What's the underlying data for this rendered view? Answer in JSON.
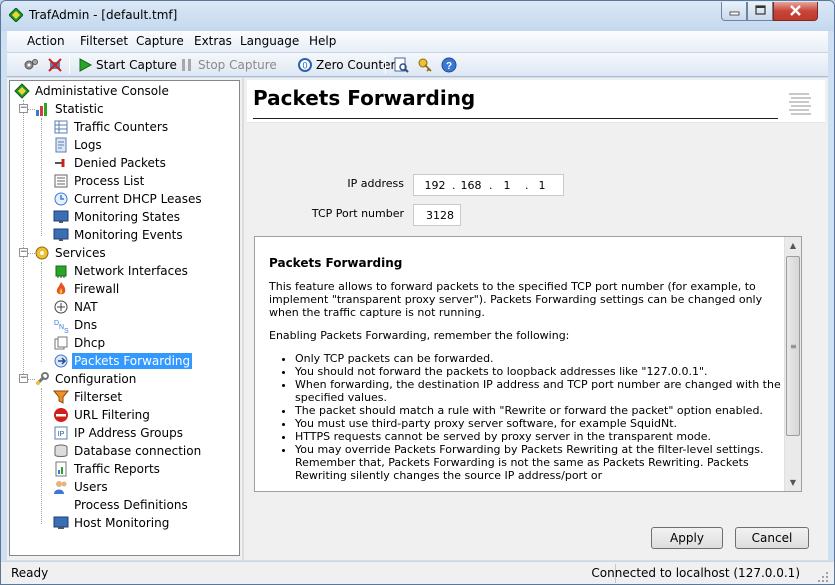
{
  "window": {
    "title": "TrafAdmin - [default.tmf]"
  },
  "menu": [
    "Action",
    "Filterset",
    "Capture",
    "Extras",
    "Language",
    "Help"
  ],
  "toolbar": {
    "start_capture": "Start Capture",
    "stop_capture": "Stop Capture",
    "zero_counters": "Zero Counters"
  },
  "tree": {
    "root": "Administative Console",
    "statistic": {
      "label": "Statistic",
      "items": [
        "Traffic Counters",
        "Logs",
        "Denied Packets",
        "Process List",
        "Current DHCP Leases",
        "Monitoring States",
        "Monitoring Events"
      ]
    },
    "services": {
      "label": "Services",
      "items": [
        "Network Interfaces",
        "Firewall",
        "NAT",
        "Dns",
        "Dhcp",
        "Packets Forwarding"
      ]
    },
    "configuration": {
      "label": "Configuration",
      "items": [
        "Filterset",
        "URL Filtering",
        "IP Address Groups",
        "Database connection",
        "Traffic Reports",
        "Users",
        "Process Definitions",
        "Host Monitoring"
      ]
    },
    "selected": "Packets Forwarding"
  },
  "page": {
    "title": "Packets Forwarding",
    "ip_label": "IP address",
    "ip": [
      "192",
      "168",
      "1",
      "1"
    ],
    "port_label": "TCP Port number",
    "port": "3128"
  },
  "help": {
    "title": "Packets Forwarding",
    "p1": "This feature allows to forward packets to the specified TCP port number (for example, to implement \"transparent proxy server\"). Packets Forwarding settings can be changed only when the traffic capture is not running.",
    "p2": "Enabling Packets Forwarding, remember the following:",
    "bullets": [
      "Only TCP packets can be forwarded.",
      "You should not forward the packets to loopback addresses like \"127.0.0.1\".",
      "When forwarding, the destination IP address and TCP port number are changed with the specified values.",
      "The packet should match a rule with \"Rewrite or forward the packet\" option enabled.",
      "You must use third-party proxy server software, for example SquidNt.",
      "HTTPS requests cannot be served by proxy server in the transparent mode.",
      "You may override Packets Forwarding by Packets Rewriting at the filter-level settings. Remember that, Packets Forwarding is not the same as Packets Rewriting. Packets Rewriting silently changes the source IP address/port or"
    ]
  },
  "buttons": {
    "apply": "Apply",
    "cancel": "Cancel"
  },
  "status": {
    "left": "Ready",
    "right": "Connected to localhost (127.0.0.1)"
  },
  "colors": {
    "selection": "#3399ff",
    "title_gradient_top": "#dbe8f6",
    "close_button": "#c8453a"
  }
}
